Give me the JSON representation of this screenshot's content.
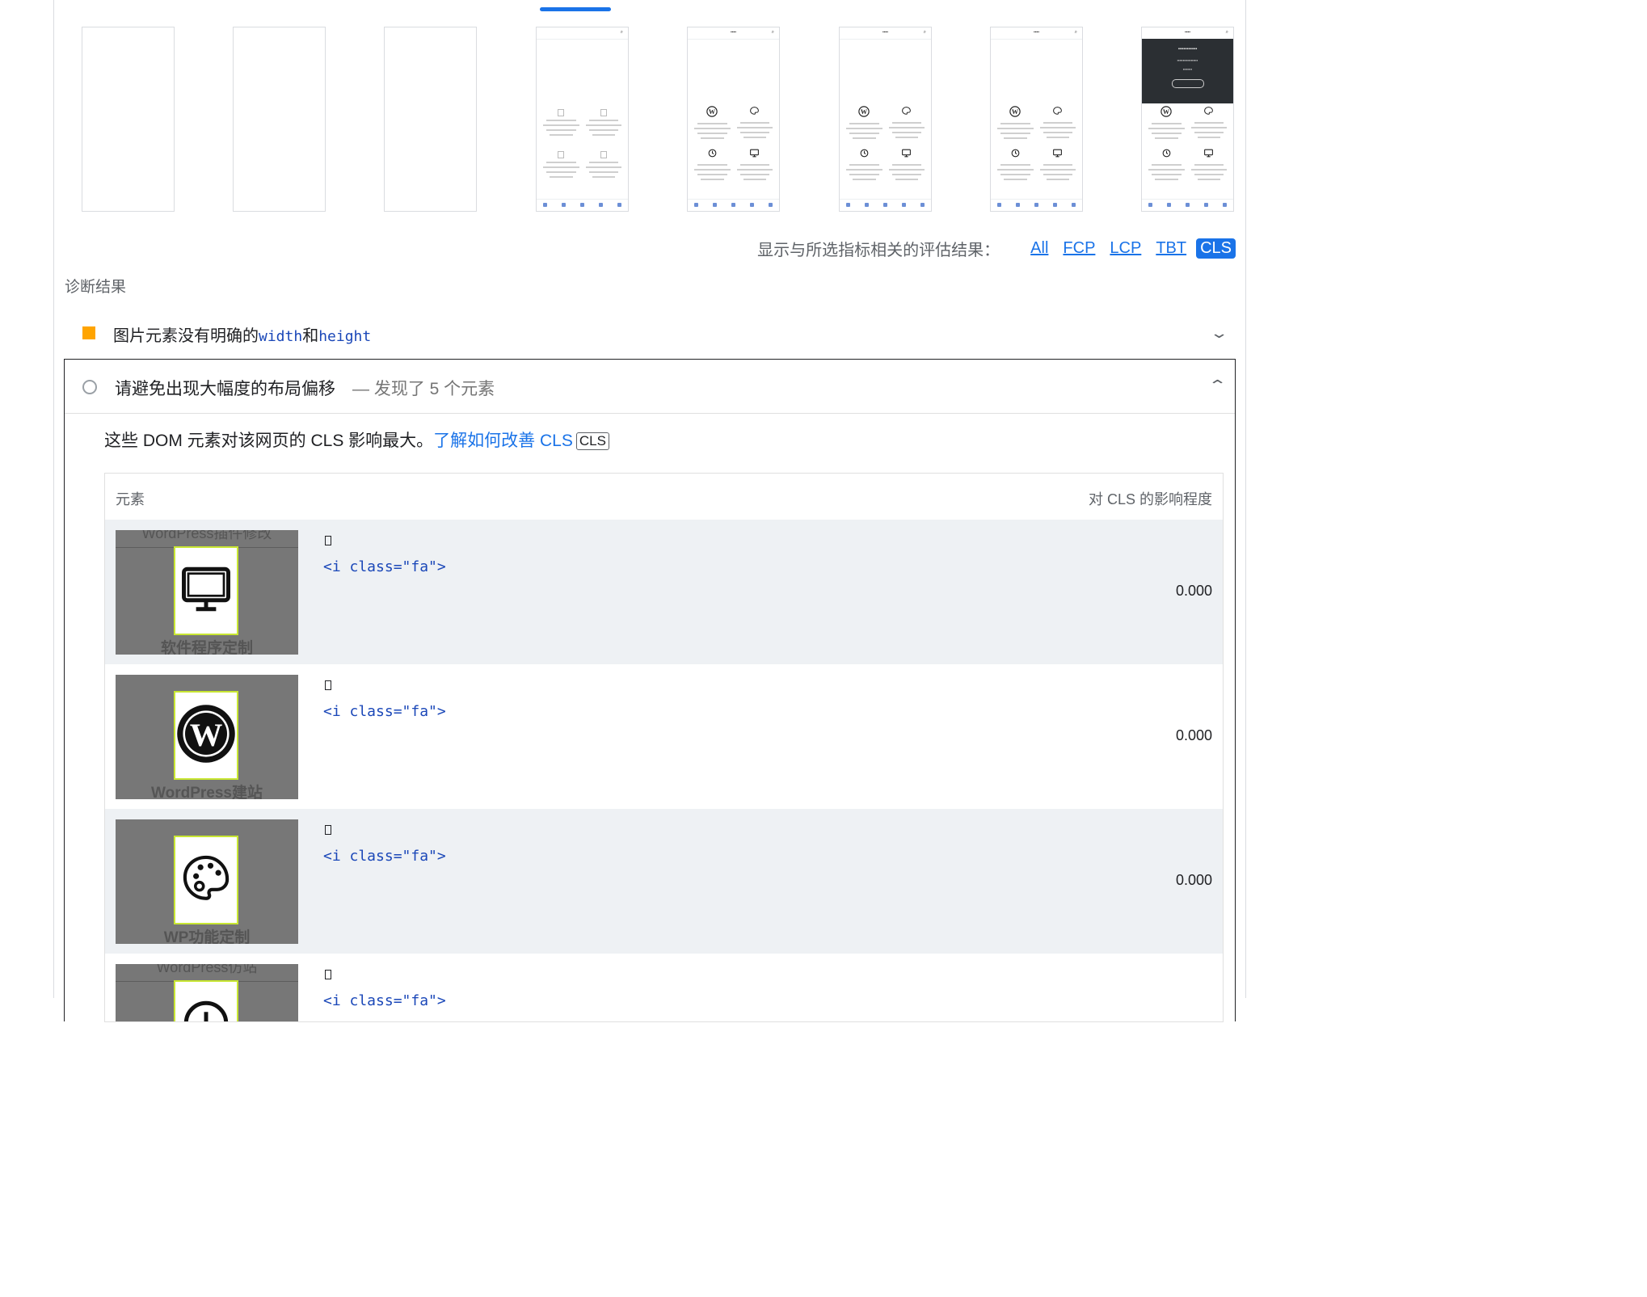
{
  "filmstrip": {
    "frames": [
      {
        "state": "blank"
      },
      {
        "state": "blank"
      },
      {
        "state": "blank"
      },
      {
        "state": "skeleton"
      },
      {
        "state": "icons"
      },
      {
        "state": "icons"
      },
      {
        "state": "icons"
      },
      {
        "state": "hero"
      }
    ]
  },
  "metric_filter": {
    "label": "显示与所选指标相关的评估结果：",
    "options": [
      "All",
      "FCP",
      "LCP",
      "TBT"
    ],
    "active": "CLS"
  },
  "diagnostics": {
    "title": "诊断结果",
    "audit_images": {
      "title_prefix": "图片元素没有明确的",
      "code_width": "width",
      "joiner": "和",
      "code_height": "height",
      "color": "#ffa400"
    },
    "audit_cls": {
      "title": "请避免出现大幅度的布局偏移",
      "display_value": "— 发现了 5 个元素",
      "description": "这些 DOM 元素对该网页的 CLS 影响最大。",
      "learn_more": "了解如何改善 CLS",
      "badge": "CLS",
      "table": {
        "col_element": "元素",
        "col_impact": "对 CLS 的影响程度",
        "rows": [
          {
            "snapshot_top": "WordPress插件修改",
            "snapshot_icon": "monitor-icon",
            "snapshot_label": "软件程序定制",
            "snippet": "<i class=\"fa\">",
            "impact": "0.000"
          },
          {
            "snapshot_top": "",
            "snapshot_icon": "wordpress-icon",
            "snapshot_label": "WordPress建站",
            "snippet": "<i class=\"fa\">",
            "impact": "0.000"
          },
          {
            "snapshot_top": "",
            "snapshot_icon": "palette-icon",
            "snapshot_label": "WP功能定制",
            "snippet": "<i class=\"fa\">",
            "impact": "0.000"
          },
          {
            "snapshot_top": "WordPress仿站",
            "snapshot_icon": "history-icon",
            "snapshot_label": "",
            "snippet": "<i class=\"fa\">",
            "impact": ""
          }
        ]
      }
    }
  }
}
